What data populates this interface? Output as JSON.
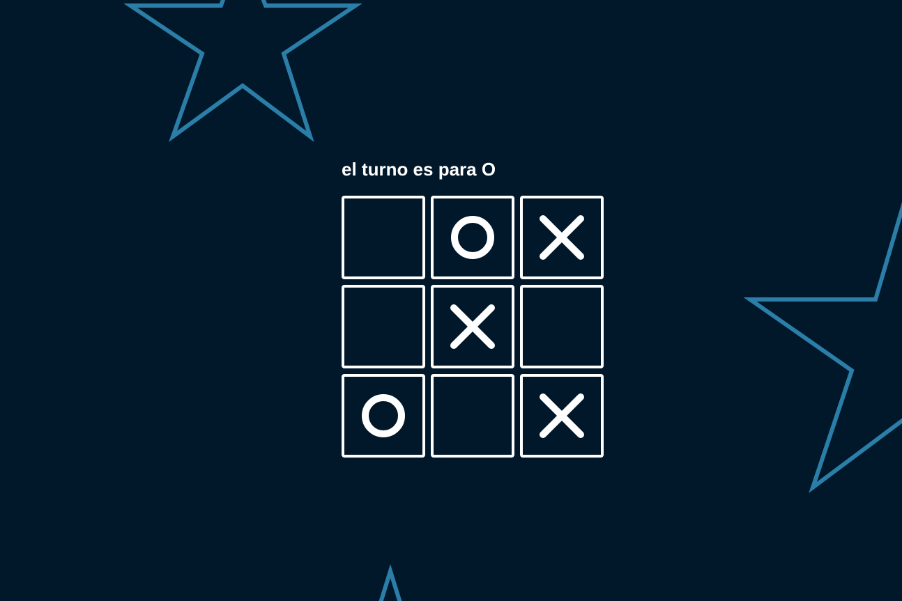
{
  "game": {
    "status": "el turno es para O",
    "board": [
      "",
      "O",
      "X",
      "",
      "X",
      "",
      "O",
      "",
      "X"
    ]
  },
  "colors": {
    "background": "#01182a",
    "star_outline": "#2a7ea8",
    "foreground": "#ffffff"
  },
  "decorations": {
    "background_icon": "star-outline-icon",
    "count": 3
  }
}
